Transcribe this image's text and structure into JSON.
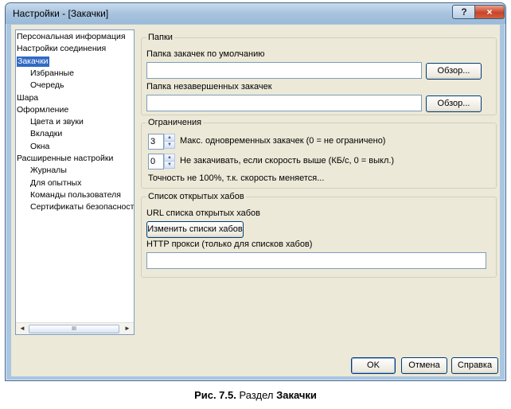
{
  "window": {
    "title": "Настройки - [Закачки]",
    "help_glyph": "?",
    "close_glyph": "×"
  },
  "tree": {
    "items": [
      {
        "label": "Персональная информация",
        "level": 0
      },
      {
        "label": "Настройки соединения",
        "level": 0
      },
      {
        "label": "Закачки",
        "level": 0,
        "selected": true
      },
      {
        "label": "Избранные",
        "level": 1
      },
      {
        "label": "Очередь",
        "level": 1
      },
      {
        "label": "Шара",
        "level": 0
      },
      {
        "label": "Оформление",
        "level": 0
      },
      {
        "label": "Цвета и звуки",
        "level": 1
      },
      {
        "label": "Вкладки",
        "level": 1
      },
      {
        "label": "Окна",
        "level": 1
      },
      {
        "label": "Расширенные настройки",
        "level": 0
      },
      {
        "label": "Журналы",
        "level": 1
      },
      {
        "label": "Для опытных",
        "level": 1
      },
      {
        "label": "Команды пользователя",
        "level": 1
      },
      {
        "label": "Сертификаты безопасности",
        "level": 1
      }
    ],
    "scroll_left": "◄",
    "scroll_right": "►",
    "scroll_grip": "III"
  },
  "folders": {
    "title": "Папки",
    "default_label": "Папка закачек по умолчанию",
    "default_value": "",
    "incomplete_label": "Папка незавершенных закачек",
    "incomplete_value": "",
    "browse_label": "Обзор..."
  },
  "limits": {
    "title": "Ограничения",
    "max_downloads_value": "3",
    "max_downloads_label": "Макс. одновременных закачек (0 = не ограничено)",
    "speed_value": "0",
    "speed_label": "Не закачивать, если скорость выше (КБ/с, 0 = выкл.)",
    "note": "Точность не 100%, т.к. скорость меняется..."
  },
  "hubs": {
    "title": "Список открытых хабов",
    "url_label": "URL списка открытых хабов",
    "edit_button": "Изменить списки хабов",
    "proxy_label": "HTTP прокси (только для списков хабов)",
    "proxy_value": ""
  },
  "buttons": {
    "ok": "OK",
    "cancel": "Отмена",
    "help": "Справка"
  },
  "caption": {
    "prefix": "Рис. 7.5.",
    "middle": " Раздел ",
    "bold": "Закачки"
  }
}
